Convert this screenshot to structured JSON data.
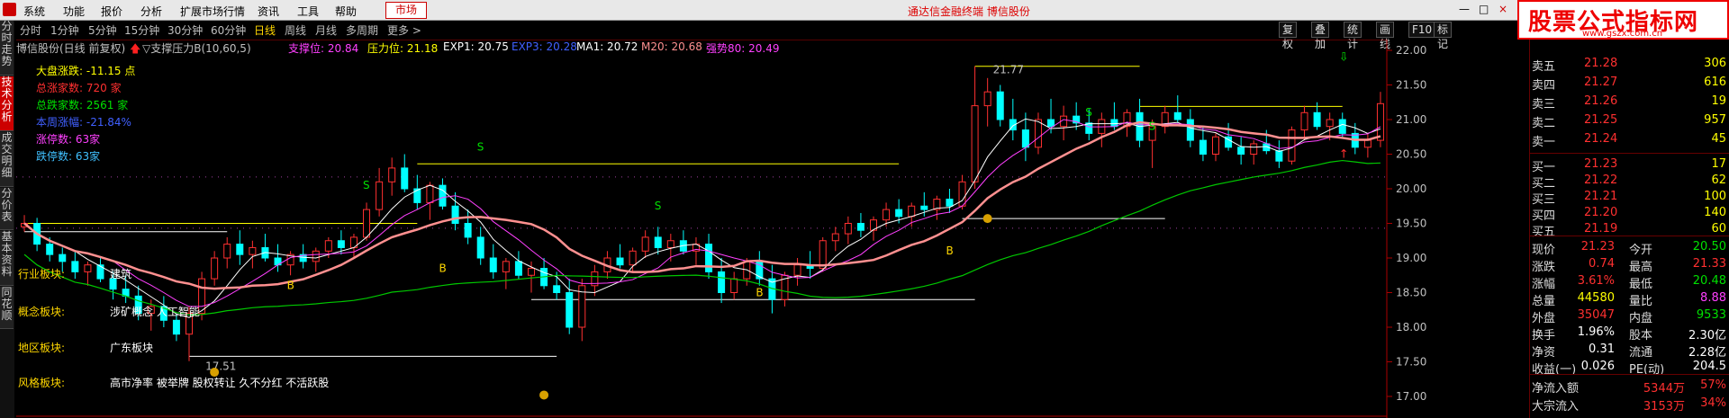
{
  "menu": {
    "items": [
      "系统",
      "功能",
      "报价",
      "分析",
      "扩展市场行情",
      "资讯",
      "工具",
      "帮助"
    ],
    "market": "市场",
    "title": "通达信金融终端  博信股份",
    "window_controls": [
      "—",
      "□",
      "×"
    ]
  },
  "toolbar": {
    "items": [
      "分时",
      "1分钟",
      "5分钟",
      "15分钟",
      "30分钟",
      "60分钟",
      "日线",
      "周线",
      "月线",
      "多周期",
      "更多 >"
    ],
    "active": "日线",
    "right_buttons": [
      "复权",
      "叠加",
      "统计",
      "画线",
      "F10",
      "标记"
    ]
  },
  "watermark": {
    "main": "股票公式指标网",
    "sub": "www.gszx.com.cn"
  },
  "left_tabs": [
    "分时走势",
    "技术分析",
    "成交明细",
    "分价表",
    "基本资料",
    "同花顺"
  ],
  "left_tab_active": "技术分析",
  "legend": {
    "stock": "博信股份(日线 前复权)",
    "indicator": "▽支撑压力B(10,60,5)",
    "support_label": "支撑位: 20.84",
    "pressure_label": "压力位: 21.18",
    "exp1": "EXP1: 20.75",
    "exp3": "EXP3: 20.28",
    "ma1": "MA1: 20.72",
    "m20": "M20: 20.68",
    "strong": "强势80: 20.49"
  },
  "info": [
    {
      "text": "大盘涨跌: -11.15 点",
      "color": "#ffff00"
    },
    {
      "text": "总涨家数: 720 家",
      "color": "#ff3030"
    },
    {
      "text": "总跌家数: 2561 家",
      "color": "#00e000"
    },
    {
      "text": "本周涨幅: -21.84%",
      "color": "#4060ff"
    },
    {
      "text": "涨停数: 63家",
      "color": "#ff40ff"
    },
    {
      "text": "跌停数: 63家",
      "color": "#40c0ff"
    }
  ],
  "sectors": [
    {
      "label": "行业板块:",
      "value": "建筑"
    },
    {
      "label": "概念板块:",
      "value": "涉矿概念  人工智能"
    },
    {
      "label": "地区板块:",
      "value": "广东板块"
    },
    {
      "label": "风格板块:",
      "value": "高市净率 被举牌 股权转让 久不分红 不活跃股"
    }
  ],
  "chart_data": {
    "type": "candlestick",
    "y_ticks": [
      "22.00",
      "21.50",
      "21.00",
      "20.50",
      "20.00",
      "19.50",
      "19.00",
      "18.50",
      "18.00",
      "17.50",
      "17.00"
    ],
    "ylim": [
      17.0,
      22.0
    ],
    "annotations": [
      {
        "text": "21.77",
        "kind": "high"
      },
      {
        "text": "17.51",
        "kind": "low"
      }
    ],
    "signals": [
      "B",
      "B",
      "S",
      "B",
      "S",
      "B",
      "S",
      "S",
      "S"
    ],
    "candles": [
      [
        19.45,
        19.62,
        19.38,
        19.5
      ],
      [
        19.5,
        19.58,
        19.1,
        19.2
      ],
      [
        19.2,
        19.3,
        18.95,
        19.05
      ],
      [
        19.05,
        19.15,
        18.8,
        18.95
      ],
      [
        18.95,
        19.1,
        18.7,
        18.8
      ],
      [
        18.8,
        18.95,
        18.6,
        18.9
      ],
      [
        18.9,
        19.0,
        18.65,
        18.7
      ],
      [
        18.7,
        18.8,
        18.4,
        18.55
      ],
      [
        18.55,
        18.75,
        18.35,
        18.45
      ],
      [
        18.45,
        18.6,
        18.1,
        18.2
      ],
      [
        18.2,
        18.4,
        17.95,
        18.3
      ],
      [
        18.3,
        18.45,
        18.0,
        18.1
      ],
      [
        18.1,
        18.2,
        17.8,
        17.9
      ],
      [
        17.9,
        18.3,
        17.51,
        18.2
      ],
      [
        18.2,
        18.8,
        18.1,
        18.7
      ],
      [
        18.7,
        19.1,
        18.6,
        19.0
      ],
      [
        19.0,
        19.3,
        18.85,
        19.2
      ],
      [
        19.2,
        19.4,
        18.9,
        19.05
      ],
      [
        19.05,
        19.25,
        18.85,
        19.15
      ],
      [
        19.15,
        19.35,
        18.95,
        19.0
      ],
      [
        19.0,
        19.2,
        18.8,
        18.9
      ],
      [
        18.9,
        19.1,
        18.75,
        19.05
      ],
      [
        19.05,
        19.2,
        18.85,
        18.95
      ],
      [
        18.95,
        19.15,
        18.8,
        19.1
      ],
      [
        19.1,
        19.3,
        19.0,
        19.25
      ],
      [
        19.25,
        19.4,
        19.05,
        19.15
      ],
      [
        19.15,
        19.35,
        19.0,
        19.3
      ],
      [
        19.3,
        19.8,
        19.25,
        19.7
      ],
      [
        19.7,
        20.3,
        19.6,
        20.1
      ],
      [
        20.1,
        20.45,
        19.9,
        20.3
      ],
      [
        20.3,
        20.5,
        19.95,
        20.0
      ],
      [
        20.0,
        20.2,
        19.7,
        19.8
      ],
      [
        19.8,
        20.1,
        19.55,
        20.05
      ],
      [
        20.05,
        20.15,
        19.7,
        19.75
      ],
      [
        19.75,
        19.95,
        19.4,
        19.5
      ],
      [
        19.5,
        19.7,
        19.2,
        19.3
      ],
      [
        19.3,
        19.45,
        18.9,
        19.0
      ],
      [
        19.0,
        19.2,
        18.7,
        18.8
      ],
      [
        18.8,
        19.0,
        18.55,
        18.95
      ],
      [
        18.95,
        19.1,
        18.7,
        18.75
      ],
      [
        18.75,
        18.95,
        18.5,
        18.85
      ],
      [
        18.85,
        19.0,
        18.55,
        18.6
      ],
      [
        18.6,
        18.8,
        18.4,
        18.5
      ],
      [
        18.5,
        18.7,
        17.9,
        18.0
      ],
      [
        18.0,
        18.7,
        17.8,
        18.6
      ],
      [
        18.6,
        18.9,
        18.45,
        18.8
      ],
      [
        18.8,
        19.1,
        18.7,
        19.0
      ],
      [
        19.0,
        19.2,
        18.85,
        18.9
      ],
      [
        18.9,
        19.15,
        18.8,
        19.1
      ],
      [
        19.1,
        19.4,
        19.0,
        19.3
      ],
      [
        19.3,
        19.45,
        19.05,
        19.15
      ],
      [
        19.15,
        19.35,
        18.95,
        19.25
      ],
      [
        19.25,
        19.4,
        19.05,
        19.1
      ],
      [
        19.1,
        19.3,
        18.9,
        19.2
      ],
      [
        19.2,
        19.35,
        18.7,
        18.8
      ],
      [
        18.8,
        19.0,
        18.35,
        18.5
      ],
      [
        18.5,
        18.8,
        18.4,
        18.7
      ],
      [
        18.7,
        19.0,
        18.6,
        18.95
      ],
      [
        18.95,
        19.1,
        18.6,
        18.7
      ],
      [
        18.7,
        18.9,
        18.2,
        18.4
      ],
      [
        18.4,
        18.8,
        18.3,
        18.75
      ],
      [
        18.75,
        19.0,
        18.6,
        18.9
      ],
      [
        18.9,
        19.1,
        18.7,
        18.85
      ],
      [
        18.85,
        19.3,
        18.8,
        19.25
      ],
      [
        19.25,
        19.45,
        19.1,
        19.35
      ],
      [
        19.35,
        19.6,
        19.2,
        19.5
      ],
      [
        19.5,
        19.65,
        19.3,
        19.4
      ],
      [
        19.4,
        19.6,
        19.25,
        19.55
      ],
      [
        19.55,
        19.8,
        19.45,
        19.7
      ],
      [
        19.7,
        19.85,
        19.5,
        19.6
      ],
      [
        19.6,
        19.8,
        19.45,
        19.75
      ],
      [
        19.75,
        19.95,
        19.6,
        19.7
      ],
      [
        19.7,
        19.9,
        19.55,
        19.85
      ],
      [
        19.85,
        20.0,
        19.65,
        19.75
      ],
      [
        19.75,
        20.2,
        19.7,
        20.1
      ],
      [
        20.1,
        21.77,
        20.0,
        21.2
      ],
      [
        21.2,
        21.6,
        20.9,
        21.4
      ],
      [
        21.4,
        21.5,
        20.9,
        21.0
      ],
      [
        21.0,
        21.3,
        20.7,
        20.85
      ],
      [
        20.85,
        21.1,
        20.4,
        20.6
      ],
      [
        20.6,
        21.1,
        20.5,
        21.0
      ],
      [
        21.0,
        21.3,
        20.8,
        20.9
      ],
      [
        20.9,
        21.2,
        20.7,
        21.05
      ],
      [
        21.05,
        21.25,
        20.85,
        20.95
      ],
      [
        20.95,
        21.15,
        20.7,
        20.8
      ],
      [
        20.8,
        21.1,
        20.6,
        21.0
      ],
      [
        21.0,
        21.25,
        20.85,
        20.9
      ],
      [
        20.9,
        21.15,
        20.75,
        21.1
      ],
      [
        21.1,
        21.3,
        20.6,
        20.7
      ],
      [
        20.7,
        21.0,
        20.3,
        20.9
      ],
      [
        20.9,
        21.2,
        20.8,
        21.1
      ],
      [
        21.1,
        21.35,
        20.95,
        21.0
      ],
      [
        21.0,
        21.15,
        20.6,
        20.7
      ],
      [
        20.7,
        20.9,
        20.4,
        20.5
      ],
      [
        20.5,
        20.8,
        20.4,
        20.75
      ],
      [
        20.75,
        20.95,
        20.55,
        20.6
      ],
      [
        20.6,
        20.75,
        20.35,
        20.5
      ],
      [
        20.5,
        20.7,
        20.35,
        20.65
      ],
      [
        20.65,
        20.85,
        20.5,
        20.55
      ],
      [
        20.55,
        20.7,
        20.3,
        20.4
      ],
      [
        20.4,
        20.9,
        20.35,
        20.85
      ],
      [
        20.85,
        21.2,
        20.7,
        21.1
      ],
      [
        21.1,
        21.25,
        20.85,
        20.9
      ],
      [
        20.9,
        21.1,
        20.7,
        21.0
      ],
      [
        21.0,
        21.1,
        20.75,
        20.8
      ],
      [
        20.8,
        20.95,
        20.5,
        20.6
      ],
      [
        20.6,
        20.8,
        20.45,
        20.7
      ],
      [
        20.7,
        21.4,
        20.6,
        21.23
      ]
    ],
    "ma_series": [
      {
        "name": "MA1",
        "color": "#ffffff"
      },
      {
        "name": "M20",
        "color": "#ff40ff"
      },
      {
        "name": "EXP1",
        "color": "#ff9090"
      },
      {
        "name": "强势80",
        "color": "#00c800"
      }
    ]
  },
  "quote": {
    "sells": [
      {
        "label": "卖五",
        "price": "21.28",
        "vol": "306"
      },
      {
        "label": "卖四",
        "price": "21.27",
        "vol": "616"
      },
      {
        "label": "卖三",
        "price": "21.26",
        "vol": "19"
      },
      {
        "label": "卖二",
        "price": "21.25",
        "vol": "957"
      },
      {
        "label": "卖一",
        "price": "21.24",
        "vol": "45"
      }
    ],
    "buys": [
      {
        "label": "买一",
        "price": "21.23",
        "vol": "17"
      },
      {
        "label": "买二",
        "price": "21.22",
        "vol": "62"
      },
      {
        "label": "买三",
        "price": "21.21",
        "vol": "100"
      },
      {
        "label": "买四",
        "price": "21.20",
        "vol": "140"
      },
      {
        "label": "买五",
        "price": "21.19",
        "vol": "60"
      }
    ],
    "stats": [
      {
        "l1": "现价",
        "v1": "21.23",
        "c1": "#ff3030",
        "l2": "今开",
        "v2": "20.50",
        "c2": "#00e000"
      },
      {
        "l1": "涨跌",
        "v1": "0.74",
        "c1": "#ff3030",
        "l2": "最高",
        "v2": "21.33",
        "c2": "#ff3030"
      },
      {
        "l1": "涨幅",
        "v1": "3.61%",
        "c1": "#ff3030",
        "l2": "最低",
        "v2": "20.48",
        "c2": "#00e000"
      },
      {
        "l1": "总量",
        "v1": "44580",
        "c1": "#ffff00",
        "l2": "量比",
        "v2": "8.88",
        "c2": "#ff40ff"
      },
      {
        "l1": "外盘",
        "v1": "35047",
        "c1": "#ff3030",
        "l2": "内盘",
        "v2": "9533",
        "c2": "#00e000"
      },
      {
        "l1": "换手",
        "v1": "1.96%",
        "c1": "#ffffff",
        "l2": "股本",
        "v2": "2.30亿",
        "c2": "#ffffff"
      },
      {
        "l1": "净资",
        "v1": "0.31",
        "c1": "#ffffff",
        "l2": "流通",
        "v2": "2.28亿",
        "c2": "#ffffff"
      },
      {
        "l1": "收益(一)",
        "v1": "0.026",
        "c1": "#ffffff",
        "l2": "PE(动)",
        "v2": "204.5",
        "c2": "#ffffff"
      }
    ],
    "flow": [
      {
        "label": "净流入额",
        "value": "5344万",
        "pct": "57%"
      },
      {
        "label": "大宗流入",
        "value": "3153万",
        "pct": "34%"
      }
    ]
  }
}
